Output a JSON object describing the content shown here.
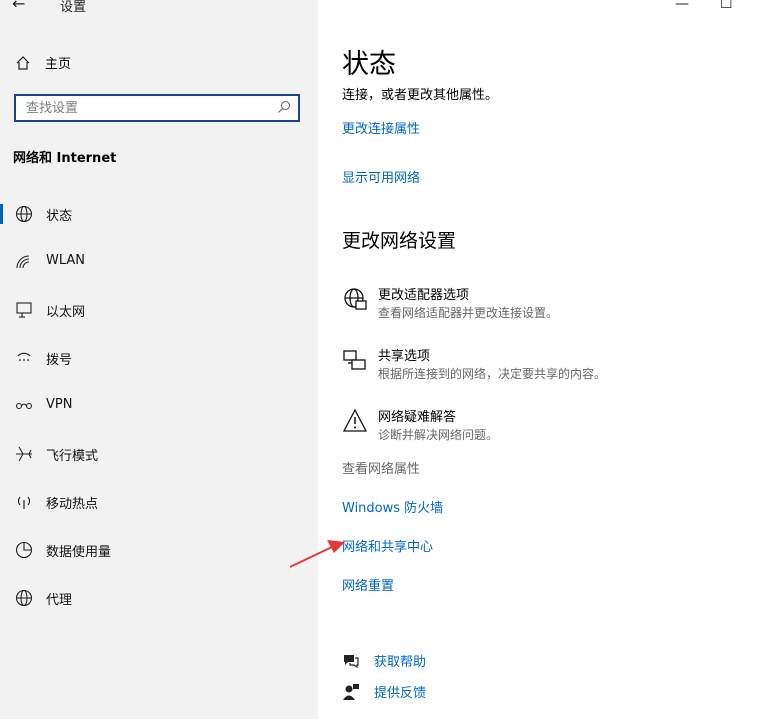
{
  "window": {
    "title": "设置",
    "back_icon": "←",
    "minimize_icon": "—",
    "maximize_icon": "☐"
  },
  "sidebar": {
    "home_label": "主页",
    "search_placeholder": "查找设置",
    "section_title": "网络和 Internet",
    "items": [
      {
        "label": "状态",
        "icon": "globe-icon",
        "active": true
      },
      {
        "label": "WLAN",
        "icon": "wifi-icon"
      },
      {
        "label": "以太网",
        "icon": "ethernet-icon"
      },
      {
        "label": "拨号",
        "icon": "dialup-icon"
      },
      {
        "label": "VPN",
        "icon": "vpn-icon"
      },
      {
        "label": "飞行模式",
        "icon": "airplane-icon"
      },
      {
        "label": "移动热点",
        "icon": "hotspot-icon"
      },
      {
        "label": "数据使用量",
        "icon": "data-usage-icon"
      },
      {
        "label": "代理",
        "icon": "globe-icon"
      }
    ]
  },
  "main": {
    "title": "状态",
    "description": "连接，或者更改其他属性。",
    "link_change_connection": "更改连接属性",
    "link_show_networks": "显示可用网络",
    "section2_title": "更改网络设置",
    "options": [
      {
        "title": "更改适配器选项",
        "subtitle": "查看网络适配器并更改连接设置。",
        "icon": "adapter-icon"
      },
      {
        "title": "共享选项",
        "subtitle": "根据所连接到的网络，决定要共享的内容。",
        "icon": "sharing-icon"
      },
      {
        "title": "网络疑难解答",
        "subtitle": "诊断并解决网络问题。",
        "icon": "warning-icon"
      }
    ],
    "view_properties": "查看网络属性",
    "link_firewall": "Windows 防火墙",
    "link_sharing_center": "网络和共享中心",
    "link_reset": "网络重置",
    "help_label": "获取帮助",
    "feedback_label": "提供反馈"
  },
  "colors": {
    "accent": "#0067c0",
    "sidebar_bg": "#f2f2f2",
    "arrow": "#e53935"
  }
}
